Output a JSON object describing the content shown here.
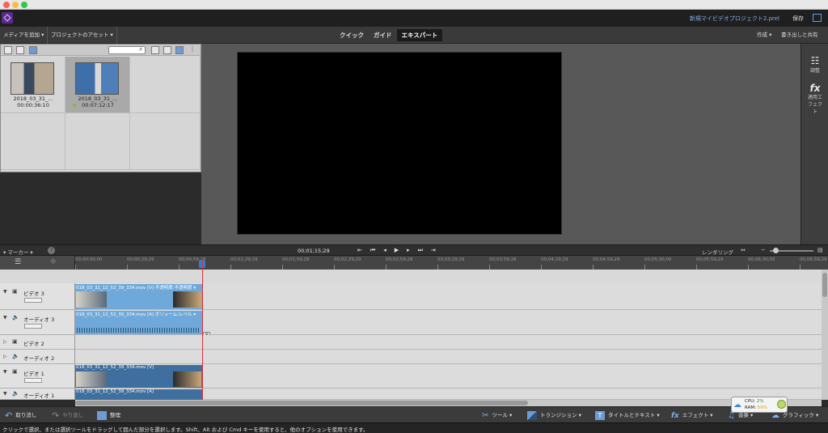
{
  "app": {
    "project_title": "新規マイビデオプロジェクト2.prel",
    "save_label": "保存"
  },
  "toolbar": {
    "add_media": "メディアを追加",
    "project_assets": "プロジェクトのアセット",
    "modes": [
      "クイック",
      "ガイド",
      "エキスパート"
    ],
    "active_mode": "エキスパート",
    "create": "作成",
    "export_share": "書き出しと共有"
  },
  "assets": {
    "items": [
      {
        "name": "2018_03_31_...",
        "duration": "00:00:36:10"
      },
      {
        "name": "2018_03_31_...",
        "duration": "00:07:12:17"
      }
    ]
  },
  "right_panel": {
    "adjust": "調整",
    "applied_effects": "適用エフェクト"
  },
  "timeline": {
    "marker": "マーカー",
    "timecode": "00;01;15;29",
    "rendering": "レンダリング",
    "ruler": [
      "00;00;00;00",
      "00;00;29;29",
      "00;00;59;28",
      "00;01;29;29",
      "00;01;59;28",
      "00;02;29;29",
      "00;02;59;28",
      "00;03;29;29",
      "00;03;59;28",
      "00;04;29;29",
      "00;04;59;29",
      "00;05;30;00",
      "00;05;59;29",
      "00;06;30;00",
      "00;06;59;29"
    ],
    "tracks": [
      {
        "label": "ビデオ 3",
        "clip": "018_03_31_12_52_39_334.mov [V] 不透明度:不透明度 ▾"
      },
      {
        "label": "オーディオ 3",
        "clip": "018_03_31_12_52_39_334.mov [A] ボリューム:レベル ▾"
      },
      {
        "label": "ビデオ 2",
        "clip": ""
      },
      {
        "label": "オーディオ 2",
        "clip": ""
      },
      {
        "label": "ビデオ 1",
        "clip": "018_03_31_12_52_39_334.mov [V]"
      },
      {
        "label": "オーディオ 1",
        "clip": "018_03_31_12_52_39_334.mov [A]"
      }
    ]
  },
  "actions": {
    "undo": "取り消し",
    "redo": "やり直し",
    "organize": "整理",
    "tools": "ツール",
    "transitions": "トランジション",
    "titles_text": "タイトルとテキスト",
    "effects": "エフェクト",
    "music": "音楽",
    "graphics": "グラフィック"
  },
  "cpu_widget": {
    "cpu_label": "CPU:",
    "cpu_value": "2%",
    "ram_label": "RAM:",
    "ram_value": "59%"
  },
  "status": "クリックで選択、または選択ツールをドラッグして囲んだ部分を選択します。Shift、Alt および Cmd キーを使用すると、他のオプションを使用できます。",
  "colors": {
    "accent_blue": "#2d7fd6",
    "playhead_red": "#e0303a",
    "clip_light": "#6fa9d9",
    "clip_dark": "#3f6f9e"
  }
}
